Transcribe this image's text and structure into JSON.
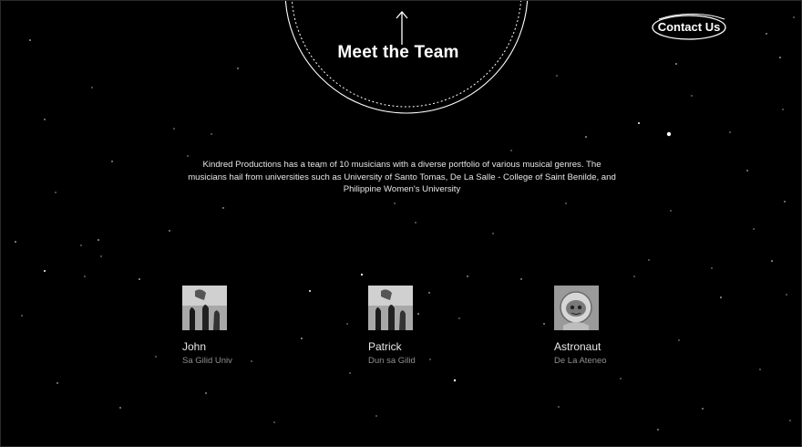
{
  "header": {
    "title": "Meet the Team",
    "contact_label": "Contact Us"
  },
  "intro": {
    "text": "Kindred Productions has a team of 10 musicians with a diverse portfolio of various musical genres. The musicians hail from universities such as University of Santo Tomas, De La Salle - College of Saint Benilde, and Philippine Women's University"
  },
  "team": [
    {
      "name": "John",
      "school": "Sa Gilid Univ",
      "avatar_icon": "figure-photo"
    },
    {
      "name": "Patrick",
      "school": "Dun sa Gilid",
      "avatar_icon": "figure-photo"
    },
    {
      "name": "Astronaut",
      "school": "De La Ateneo",
      "avatar_icon": "astronaut-photo"
    }
  ],
  "colors": {
    "background": "#000000",
    "text": "#ffffff",
    "muted": "#8f8f8f"
  }
}
